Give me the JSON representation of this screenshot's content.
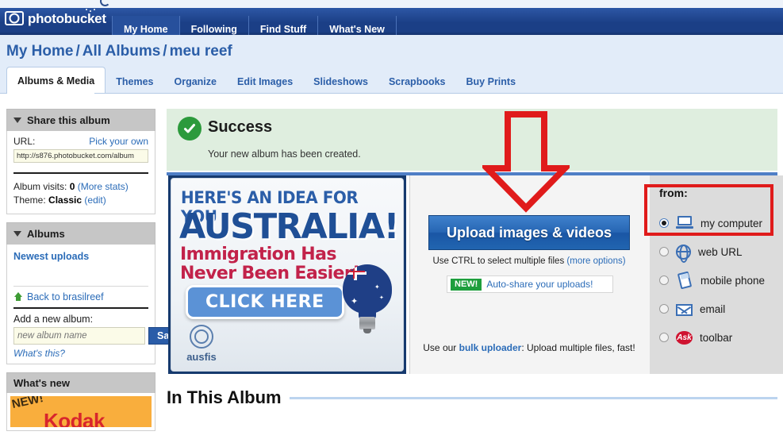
{
  "navbar": {
    "brand": "photobucket",
    "items": [
      {
        "label": "My Home",
        "active": true
      },
      {
        "label": "Following",
        "active": false
      },
      {
        "label": "Find Stuff",
        "active": false
      },
      {
        "label": "What's New",
        "active": false
      }
    ]
  },
  "breadcrumb": {
    "items": [
      "My Home",
      "All Albums",
      "meu reef"
    ],
    "separator": "/"
  },
  "tabs": [
    {
      "label": "Albums & Media",
      "active": true
    },
    {
      "label": "Themes",
      "active": false
    },
    {
      "label": "Organize",
      "active": false
    },
    {
      "label": "Edit Images",
      "active": false
    },
    {
      "label": "Slideshows",
      "active": false
    },
    {
      "label": "Scrapbooks",
      "active": false
    },
    {
      "label": "Buy Prints",
      "active": false
    }
  ],
  "sidebar": {
    "share": {
      "title": "Share this album",
      "url_label": "URL:",
      "pick_your_own": "Pick your own",
      "url_value": "http://s876.photobucket.com/album",
      "visits_label": "Album visits:",
      "visits_value": "0",
      "more_stats": "(More stats)",
      "theme_label": "Theme:",
      "theme_value": "Classic",
      "theme_edit": "(edit)"
    },
    "albums": {
      "title": "Albums",
      "newest_uploads": "Newest uploads",
      "back_link": "Back to brasilreef",
      "add_label": "Add a new album:",
      "add_placeholder": "new album name",
      "save_label": "Save",
      "whats_this": "What's this?"
    },
    "whats_new": {
      "title": "What's new",
      "ad_new": "NEW!",
      "ad_brand": "Kodak"
    }
  },
  "main": {
    "success": {
      "title": "Success",
      "message": "Your new album has been created."
    },
    "ad": {
      "line1": "HERE'S AN IDEA FOR YOU",
      "line2": "AUSTRALIA!",
      "line3a": "Immigration Has",
      "line3b": "Never Been Easier!",
      "cta": "CLICK HERE",
      "brand": "ausfis"
    },
    "upload": {
      "button_label": "Upload images & videos",
      "hint_text": "Use CTRL to select multiple files",
      "hint_link": "(more options)",
      "new_badge": "NEW!",
      "new_text": "Auto-share your uploads!",
      "bulk_prefix": "Use our ",
      "bulk_link": "bulk uploader",
      "bulk_suffix": ": Upload multiple files, fast!"
    },
    "from": {
      "title": "from:",
      "options": [
        {
          "label": "my computer",
          "icon": "laptop-icon",
          "selected": true
        },
        {
          "label": "web URL",
          "icon": "globe-icon",
          "selected": false
        },
        {
          "label": "mobile phone",
          "icon": "mobile-phone-icon",
          "selected": false
        },
        {
          "label": "email",
          "icon": "envelope-icon",
          "selected": false
        },
        {
          "label": "toolbar",
          "icon": "ask-toolbar-icon",
          "selected": false
        }
      ],
      "ask_badge": "Ask"
    },
    "in_this_album": "In This Album"
  },
  "annotations": {
    "arrow_color": "#e01b1b",
    "highlight_color": "#e01b1b"
  },
  "colors": {
    "nav_blue": "#1b3f86",
    "link_blue": "#2b6cb8",
    "success_green": "#2c9a3c",
    "accent_red": "#e01b1b"
  }
}
